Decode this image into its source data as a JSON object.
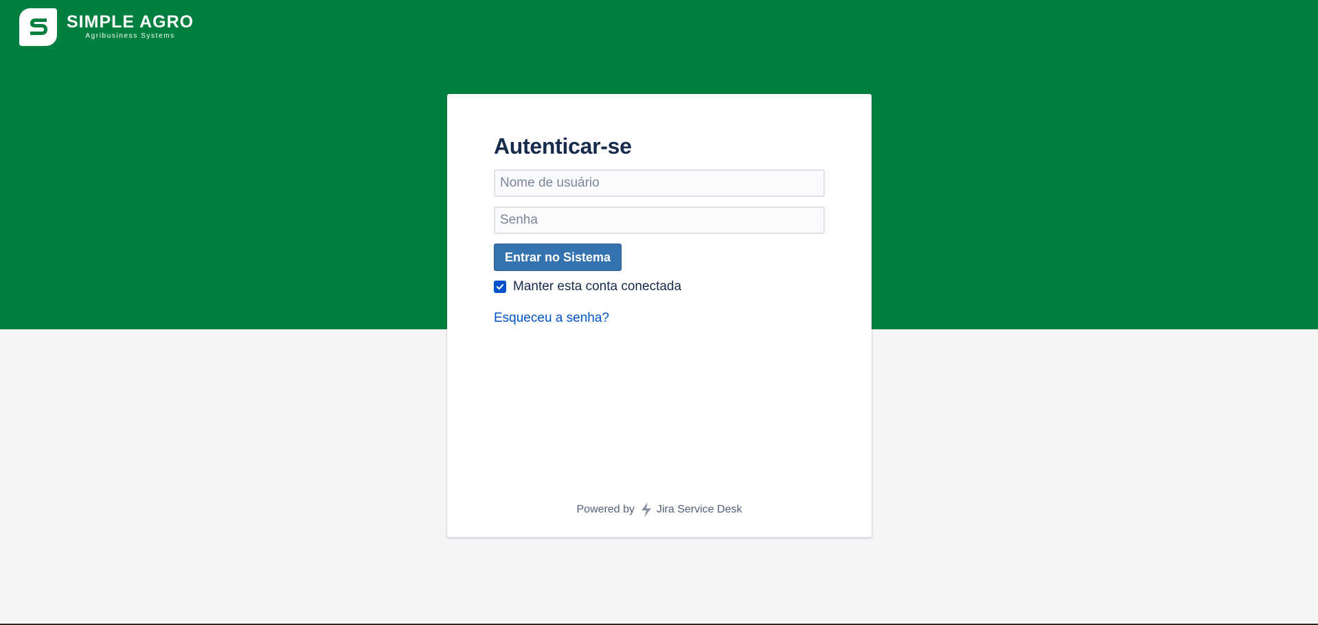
{
  "brand": {
    "name": "SIMPLE AGRO",
    "tagline": "Agribusiness Systems"
  },
  "login": {
    "title": "Autenticar-se",
    "username_placeholder": "Nome de usuário",
    "password_placeholder": "Senha",
    "submit_label": "Entrar no Sistema",
    "remember_label": "Manter esta conta conectada",
    "remember_checked": true,
    "forgot_link": "Esqueceu a senha?"
  },
  "footer": {
    "powered_by": "Powered by",
    "product": "Jira Service Desk"
  },
  "colors": {
    "hero_green": "#007f3f",
    "button_blue": "#3572b0",
    "link_blue": "#0052cc",
    "page_bg": "#f4f5f7"
  }
}
